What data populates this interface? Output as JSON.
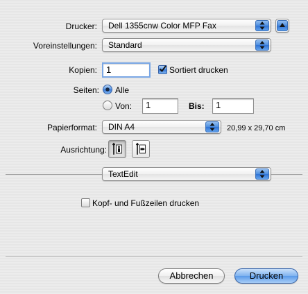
{
  "printer": {
    "label": "Drucker:",
    "value": "Dell 1355cnw Color MFP Fax"
  },
  "presets": {
    "label": "Voreinstellungen:",
    "value": "Standard"
  },
  "copies": {
    "label": "Kopien:",
    "value": "1",
    "collate_label": "Sortiert drucken",
    "collate_checked": true
  },
  "pages": {
    "label": "Seiten:",
    "all_label": "Alle",
    "from_label": "Von:",
    "from_value": "1",
    "to_label": "Bis:",
    "to_value": "1",
    "selected": "Alle"
  },
  "paper": {
    "label": "Papierformat:",
    "value": "DIN A4",
    "size_text": "20,99 x 29,70 cm"
  },
  "orientation": {
    "label": "Ausrichtung:",
    "selected": "portrait"
  },
  "section": {
    "value": "TextEdit"
  },
  "header_footer": {
    "label": "Kopf- und Fußzeilen drucken",
    "checked": false
  },
  "buttons": {
    "cancel": "Abbrechen",
    "print": "Drucken"
  },
  "icons": {
    "popup": "up-down-arrows-icon",
    "disclosure": "disclosure-triangle-icon",
    "portrait": "portrait-orientation-icon",
    "landscape": "landscape-orientation-icon"
  }
}
